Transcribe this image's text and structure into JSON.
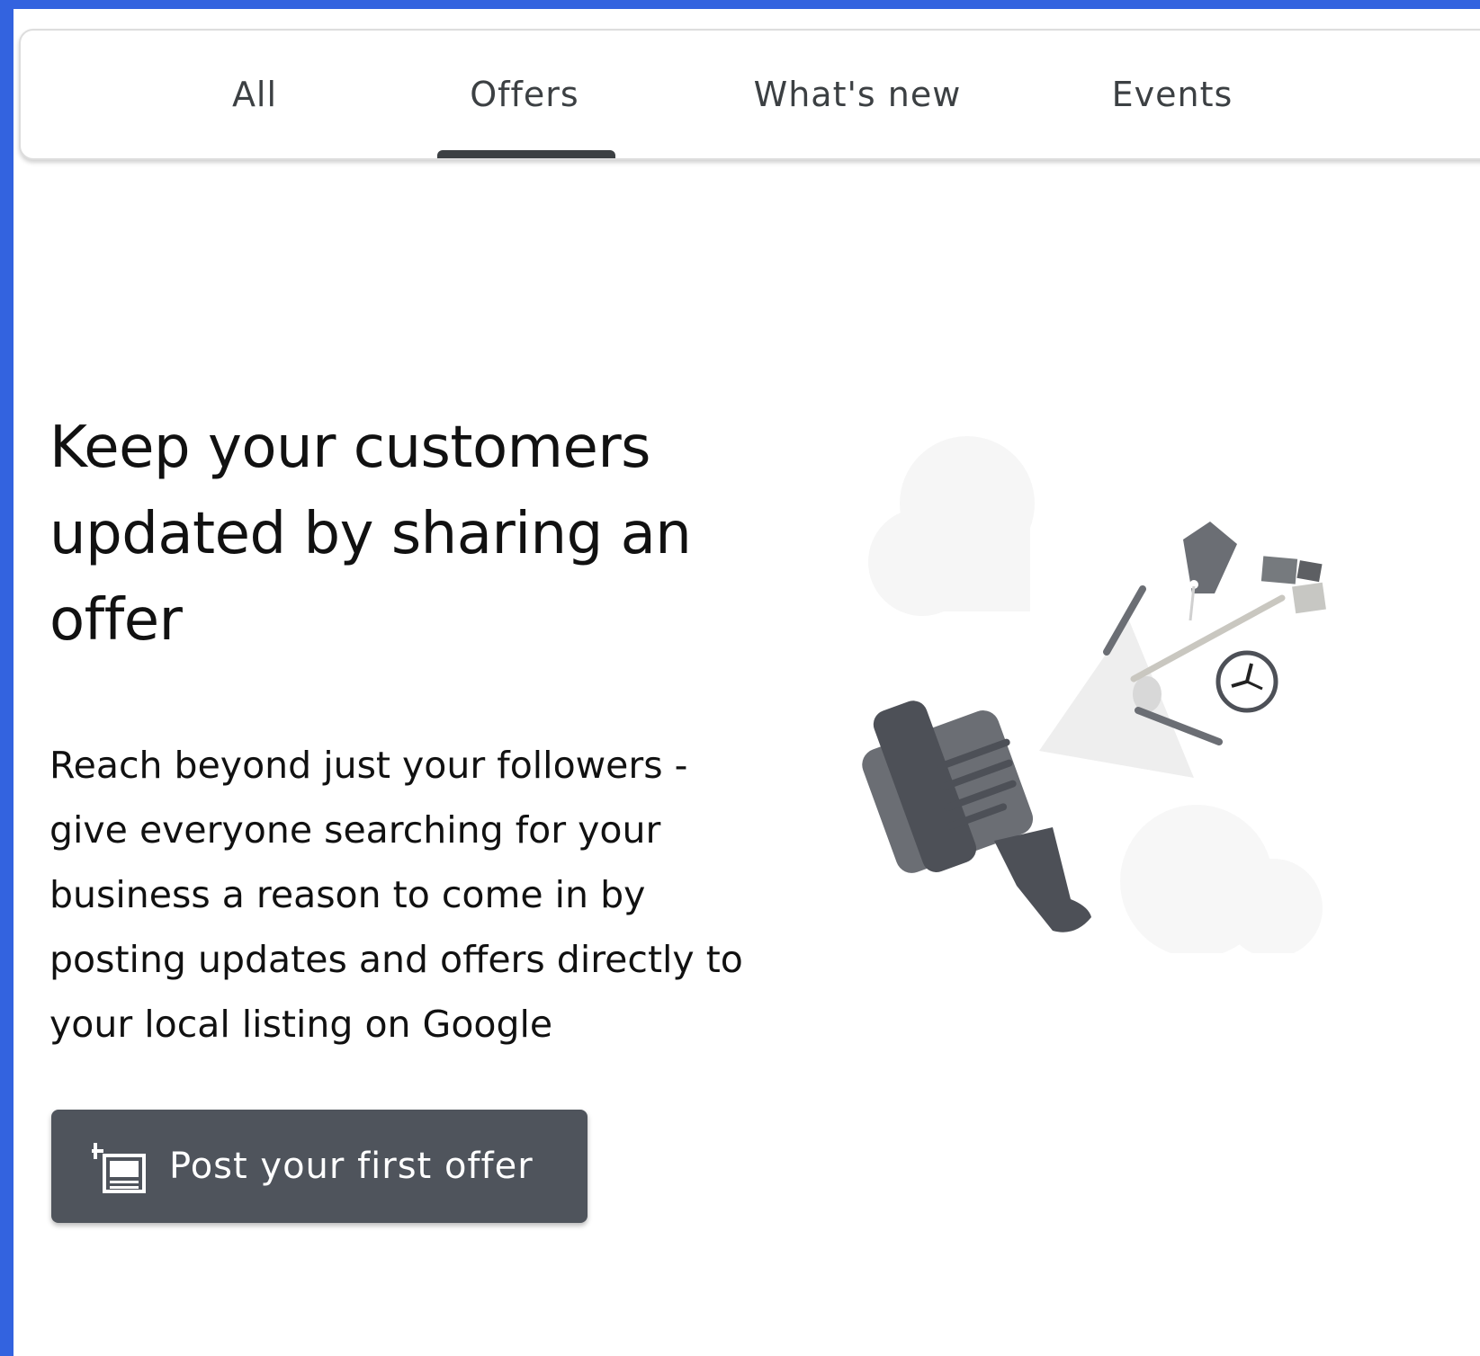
{
  "tabs": {
    "items": [
      {
        "label": "All"
      },
      {
        "label": "Offers"
      },
      {
        "label": "What's new"
      },
      {
        "label": "Events"
      }
    ],
    "selected": "Offers"
  },
  "empty_state": {
    "headline": "Keep your customers updated by sharing an offer",
    "description": "Reach beyond just your followers - give everyone searching for your business a reason to come in by posting updates and offers directly to your local listing on Google",
    "button_label": "Post your first offer",
    "button_icon": "add-post-icon",
    "illustration": "megaphone-illustration"
  },
  "colors": {
    "window_border": "#3363df",
    "tab_text": "#3c4043",
    "button_bg": "#4f545c",
    "button_text": "#ffffff"
  }
}
